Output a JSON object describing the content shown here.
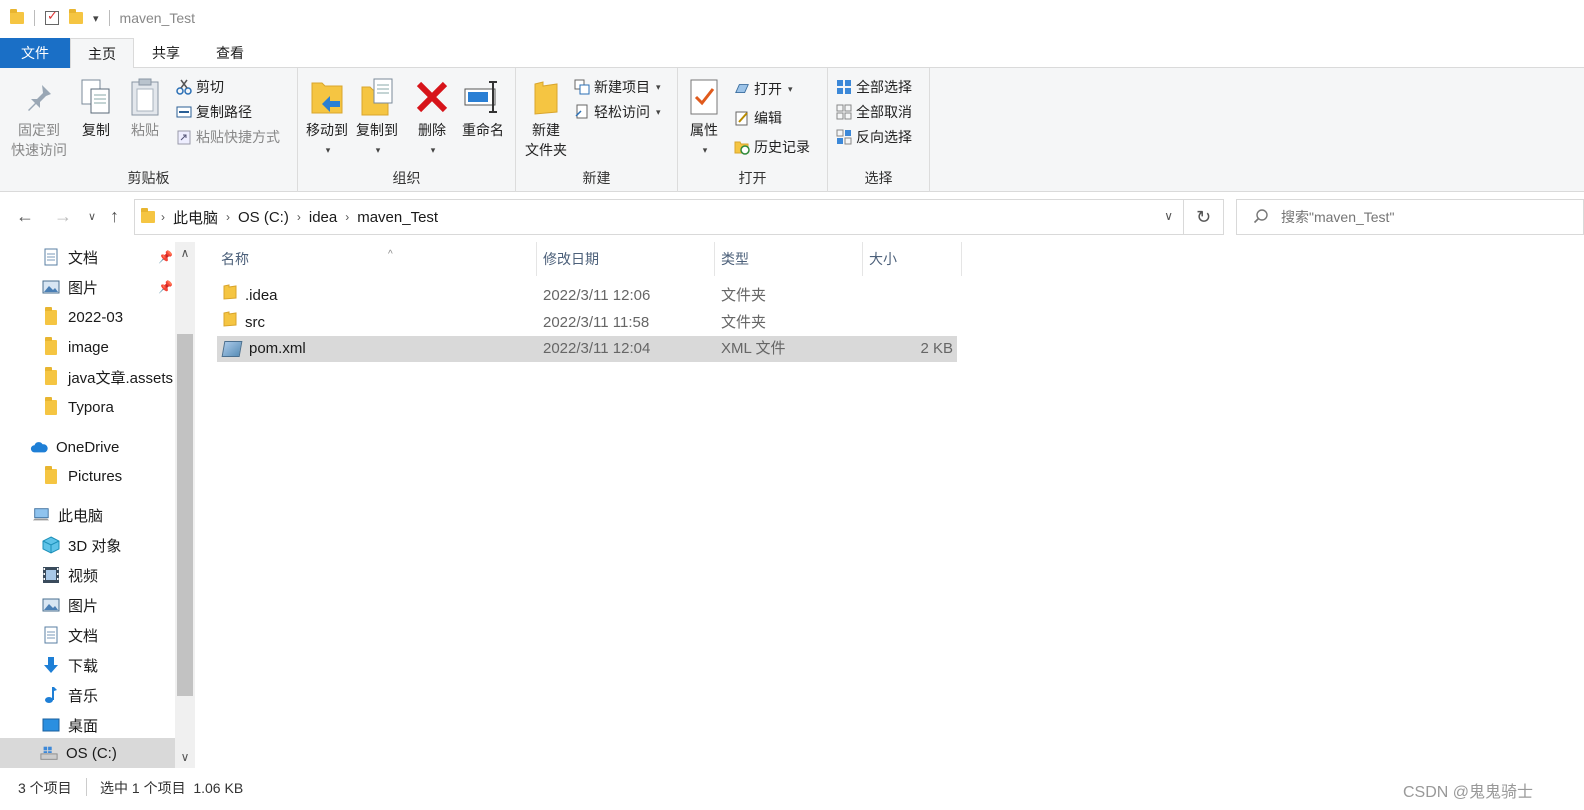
{
  "window": {
    "title": "maven_Test"
  },
  "tabs": [
    {
      "label": "文件"
    },
    {
      "label": "主页"
    },
    {
      "label": "共享"
    },
    {
      "label": "查看"
    }
  ],
  "ribbon": {
    "clipboard": {
      "label": "剪贴板",
      "pin_label_1": "固定到",
      "pin_label_2": "快速访问",
      "copy": "复制",
      "paste": "粘贴",
      "cut": "剪切",
      "copy_path": "复制路径",
      "paste_shortcut": "粘贴快捷方式"
    },
    "organize": {
      "label": "组织",
      "move_to": "移动到",
      "copy_to": "复制到",
      "delete": "删除",
      "rename": "重命名"
    },
    "new": {
      "label": "新建",
      "new_folder_1": "新建",
      "new_folder_2": "文件夹",
      "new_item": "新建项目",
      "easy_access": "轻松访问"
    },
    "open": {
      "label": "打开",
      "properties": "属性",
      "open": "打开",
      "edit": "编辑",
      "history": "历史记录"
    },
    "select": {
      "label": "选择",
      "select_all": "全部选择",
      "select_none": "全部取消",
      "invert": "反向选择"
    }
  },
  "address": {
    "crumbs": [
      "此电脑",
      "OS (C:)",
      "idea",
      "maven_Test"
    ]
  },
  "search": {
    "placeholder": "搜索\"maven_Test\""
  },
  "nav": {
    "items": [
      {
        "label": "文档",
        "pinned": true
      },
      {
        "label": "图片",
        "pinned": true
      },
      {
        "label": "2022-03"
      },
      {
        "label": "image"
      },
      {
        "label": "java文章.assets"
      },
      {
        "label": "Typora"
      },
      {
        "label": "OneDrive"
      },
      {
        "label": "Pictures"
      },
      {
        "label": "此电脑"
      },
      {
        "label": "3D 对象"
      },
      {
        "label": "视频"
      },
      {
        "label": "图片"
      },
      {
        "label": "文档"
      },
      {
        "label": "下载"
      },
      {
        "label": "音乐"
      },
      {
        "label": "桌面"
      },
      {
        "label": "OS (C:)"
      }
    ]
  },
  "columns": {
    "name": "名称",
    "date": "修改日期",
    "type": "类型",
    "size": "大小"
  },
  "files": [
    {
      "name": ".idea",
      "date": "2022/3/11 12:06",
      "type": "文件夹",
      "size": ""
    },
    {
      "name": "src",
      "date": "2022/3/11 11:58",
      "type": "文件夹",
      "size": ""
    },
    {
      "name": "pom.xml",
      "date": "2022/3/11 12:04",
      "type": "XML 文件",
      "size": "2 KB"
    }
  ],
  "status": {
    "count": "3 个项目",
    "selected": "选中 1 个项目  1.06 KB"
  },
  "watermark": "CSDN @鬼鬼骑士",
  "colors": {
    "accent": "#1a6fc6",
    "folder": "#f5c542",
    "selection": "#d9d9d9"
  }
}
